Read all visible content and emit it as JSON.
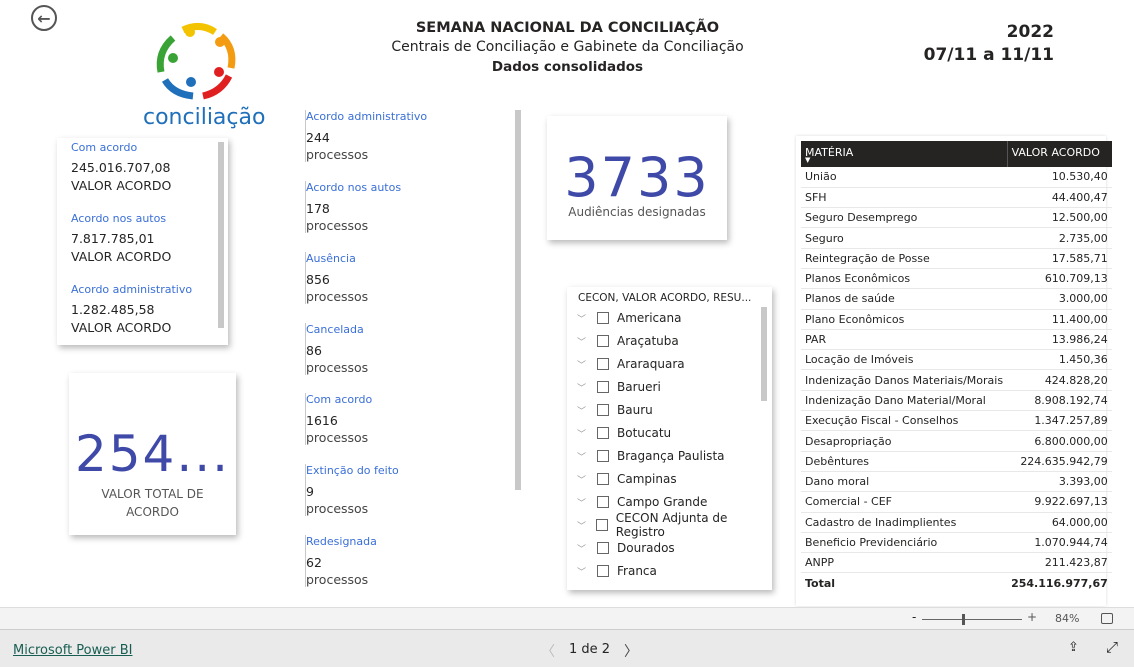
{
  "header": {
    "title": "SEMANA NACIONAL DA CONCILIAÇÃO",
    "subtitle": "Centrais de Conciliação e Gabinete da Conciliação",
    "subtitle2": "Dados consolidados",
    "year": "2022",
    "dates": "07/11 a 11/11"
  },
  "logo": {
    "text": "conciliação"
  },
  "left_card": {
    "items": [
      {
        "label": "Com acordo",
        "value": "245.016.707,08",
        "sub": "VALOR ACORDO"
      },
      {
        "label": "Acordo nos autos",
        "value": "7.817.785,01",
        "sub": "VALOR ACORDO"
      },
      {
        "label": "Acordo administrativo",
        "value": "1.282.485,58",
        "sub": "VALOR ACORDO"
      }
    ]
  },
  "total_card": {
    "value": "254...",
    "label": "VALOR TOTAL DE ACORDO"
  },
  "middle_list": {
    "items": [
      {
        "label": "Acordo administrativo",
        "value": "244",
        "sub": "processos"
      },
      {
        "label": "Acordo nos autos",
        "value": "178",
        "sub": "processos"
      },
      {
        "label": "Ausência",
        "value": "856",
        "sub": "processos"
      },
      {
        "label": "Cancelada",
        "value": "86",
        "sub": "processos"
      },
      {
        "label": "Com acordo",
        "value": "1616",
        "sub": "processos"
      },
      {
        "label": "Extinção do feito",
        "value": "9",
        "sub": "processos"
      },
      {
        "label": "Redesignada",
        "value": "62",
        "sub": "processos"
      }
    ]
  },
  "audiencias_card": {
    "value": "3733",
    "label": "Audiências designadas"
  },
  "slicer": {
    "title": "CECON, VALOR ACORDO, RESU...",
    "items": [
      "Americana",
      "Araçatuba",
      "Araraquara",
      "Barueri",
      "Bauru",
      "Botucatu",
      "Bragança Paulista",
      "Campinas",
      "Campo Grande",
      "CECON Adjunta de Registro",
      "Dourados",
      "Franca"
    ]
  },
  "table": {
    "columns": [
      "MATÉRIA",
      "VALOR ACORDO"
    ],
    "rows": [
      [
        "União",
        "10.530,40"
      ],
      [
        "SFH",
        "44.400,47"
      ],
      [
        "Seguro Desemprego",
        "12.500,00"
      ],
      [
        "Seguro",
        "2.735,00"
      ],
      [
        "Reintegração de Posse",
        "17.585,71"
      ],
      [
        "Planos Econômicos",
        "610.709,13"
      ],
      [
        "Planos de saúde",
        "3.000,00"
      ],
      [
        "Plano Econômicos",
        "11.400,00"
      ],
      [
        "PAR",
        "13.986,24"
      ],
      [
        "Locação de Imóveis",
        "1.450,36"
      ],
      [
        "Indenização Danos Materiais/Morais",
        "424.828,20"
      ],
      [
        "Indenização Dano Material/Moral",
        "8.908.192,74"
      ],
      [
        "Execução Fiscal - Conselhos",
        "1.347.257,89"
      ],
      [
        "Desapropriação",
        "6.800.000,00"
      ],
      [
        "Debêntures",
        "224.635.942,79"
      ],
      [
        "Dano moral",
        "3.393,00"
      ],
      [
        "Comercial - CEF",
        "9.922.697,13"
      ],
      [
        "Cadastro de Inadimplientes",
        "64.000,00"
      ],
      [
        "Beneficio Previdenciário",
        "1.070.944,74"
      ],
      [
        "ANPP",
        "211.423,87"
      ]
    ],
    "total_label": "Total",
    "total_value": "254.116.977,67"
  },
  "zoombar": {
    "zoom": "84%",
    "minus": "-",
    "plus": "+"
  },
  "footer": {
    "brand": "Microsoft Power BI",
    "page": "1 de 2"
  },
  "colors": {
    "accent": "#3f4aa8",
    "label_blue": "#3a6fd8",
    "table_header": "#252423"
  }
}
